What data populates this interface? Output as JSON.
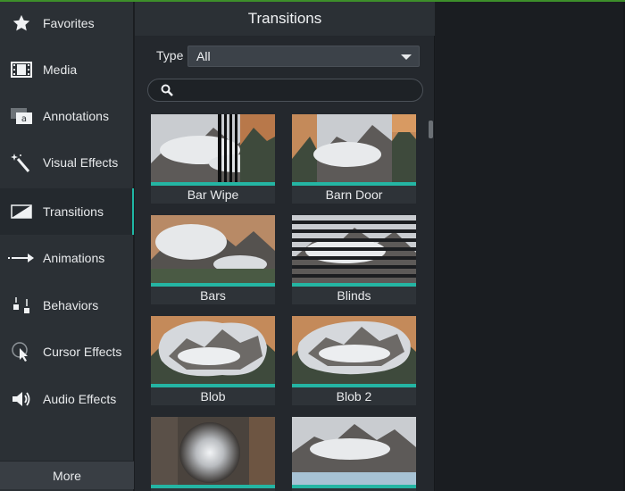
{
  "sidebar": {
    "items": [
      {
        "label": "Favorites",
        "icon": "star-icon"
      },
      {
        "label": "Media",
        "icon": "film-icon"
      },
      {
        "label": "Annotations",
        "icon": "annotation-icon"
      },
      {
        "label": "Visual Effects",
        "icon": "magic-wand-icon"
      },
      {
        "label": "Transitions",
        "icon": "transition-icon",
        "active": true
      },
      {
        "label": "Animations",
        "icon": "animation-arrow-icon"
      },
      {
        "label": "Behaviors",
        "icon": "behaviors-icon"
      },
      {
        "label": "Cursor Effects",
        "icon": "cursor-icon"
      },
      {
        "label": "Audio Effects",
        "icon": "speaker-icon"
      }
    ],
    "more_label": "More"
  },
  "panel": {
    "title": "Transitions",
    "type_label": "Type",
    "type_value": "All",
    "search_placeholder": "",
    "tiles": [
      {
        "label": "Bar Wipe"
      },
      {
        "label": "Barn Door"
      },
      {
        "label": "Bars"
      },
      {
        "label": "Blinds"
      },
      {
        "label": "Blob"
      },
      {
        "label": "Blob 2"
      },
      {
        "label": ""
      },
      {
        "label": ""
      }
    ]
  },
  "colors": {
    "accent": "#24b5a3",
    "sidebar_bg": "#2b3035",
    "panel_bg": "#24282d"
  }
}
